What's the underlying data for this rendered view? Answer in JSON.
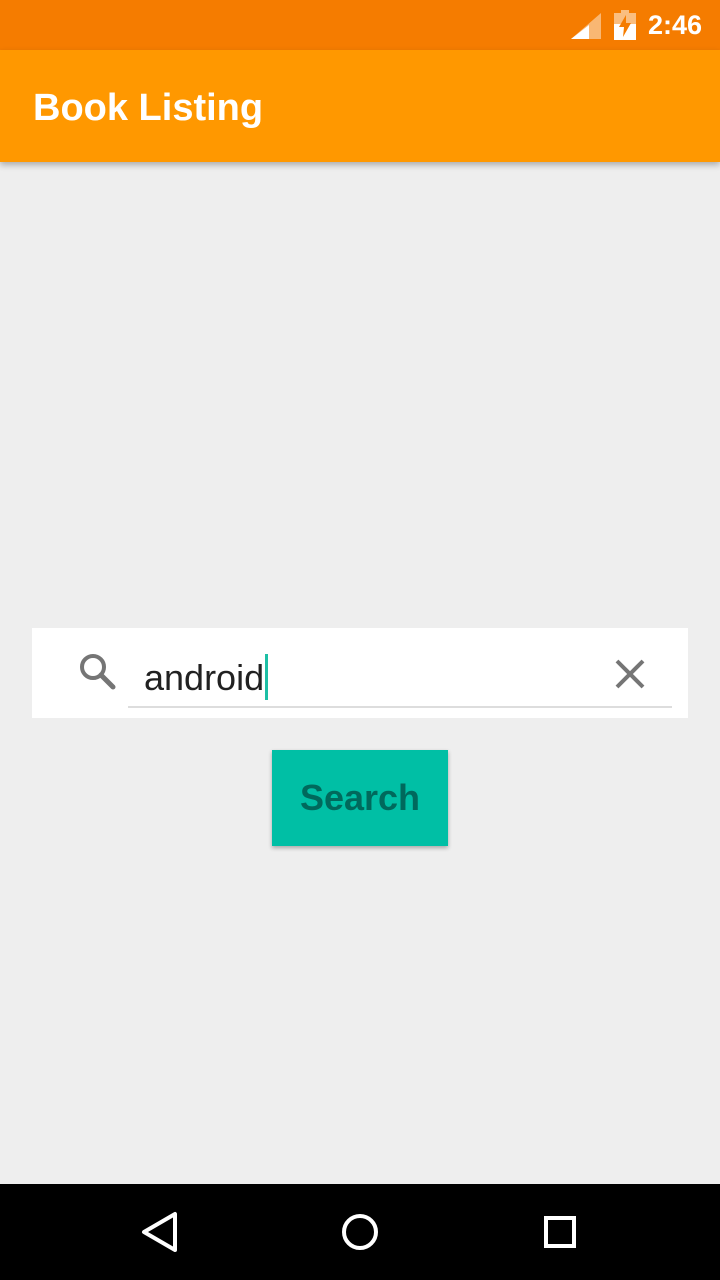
{
  "status_bar": {
    "time": "2:46",
    "icons": [
      "cell-signal-icon",
      "battery-charging-icon"
    ]
  },
  "app_bar": {
    "title": "Book Listing"
  },
  "search": {
    "query": "android",
    "icons": [
      "search-icon",
      "clear-icon"
    ]
  },
  "search_button": {
    "label": "Search"
  },
  "nav_bar": {
    "icons": [
      "back-icon",
      "home-icon",
      "recents-icon"
    ]
  },
  "colors": {
    "status_bar": "#F57C00",
    "app_bar": "#FF9800",
    "accent": "#00BFA5",
    "background": "#EEEEEE"
  }
}
